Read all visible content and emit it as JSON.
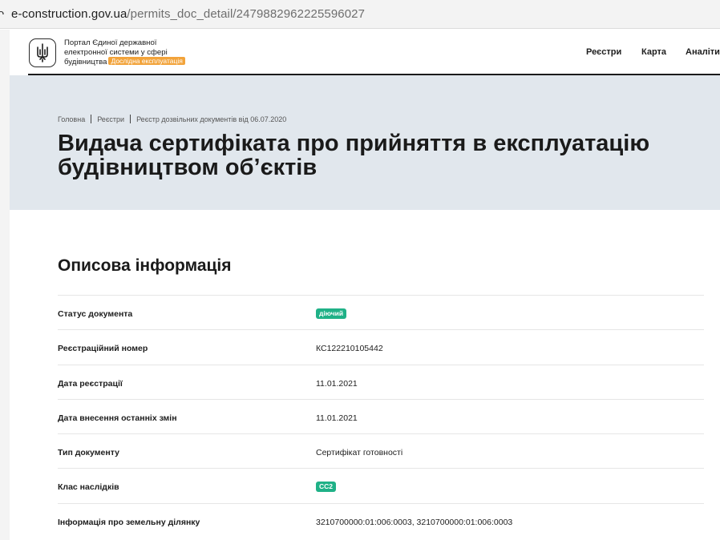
{
  "browser": {
    "url_host": "e-construction.gov.ua",
    "url_path": "/permits_doc_detail/2479882962225596027"
  },
  "header": {
    "portal_name_line1": "Портал Єдиної державної",
    "portal_name_line2": "електронної системи у сфері",
    "portal_name_line3": "будівництва",
    "beta_badge": "Дослідна експлуатація",
    "nav": [
      "Реєстри",
      "Карта",
      "Аналіти"
    ]
  },
  "breadcrumb": [
    "Головна",
    "Реєстри",
    "Реєстр дозвільних документів від 06.07.2020"
  ],
  "page_title_line1": "Видача сертифіката про прийняття в експлуатацію",
  "page_title_line2": "будівництвом об’єктів",
  "section_title": "Описова інформація",
  "rows": [
    {
      "label": "Статус документа",
      "value": "діючий"
    },
    {
      "label": "Реєстраційний номер",
      "value": "КС122210105442"
    },
    {
      "label": "Дата реєстрації",
      "value": "11.01.2021"
    },
    {
      "label": "Дата внесення останніх змін",
      "value": "11.01.2021"
    },
    {
      "label": "Тип документу",
      "value": "Сертифікат готовності"
    },
    {
      "label": "Клас наслідків",
      "value": "СС2"
    },
    {
      "label": "Інформація про земельну ділянку",
      "value": "3210700000:01:006:0003, 3210700000:01:006:0003"
    }
  ],
  "colors": {
    "hero_bg": "#e1e7ed",
    "tag_green": "#1fb187",
    "beta_orange": "#f2a33a"
  },
  "icons": {
    "logo": "trident-emblem-icon",
    "url_lock": "lock-icon"
  }
}
